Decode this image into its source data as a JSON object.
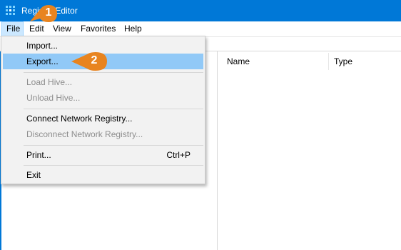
{
  "window": {
    "title": "Registry Editor",
    "icon": "regedit-icon"
  },
  "menubar": {
    "items": [
      {
        "label": "File"
      },
      {
        "label": "Edit"
      },
      {
        "label": "View"
      },
      {
        "label": "Favorites"
      },
      {
        "label": "Help"
      }
    ]
  },
  "file_menu": {
    "import": "Import...",
    "export": "Export...",
    "load_hive": "Load Hive...",
    "unload_hive": "Unload Hive...",
    "connect": "Connect Network Registry...",
    "disconnect": "Disconnect Network Registry...",
    "print": "Print...",
    "print_shortcut": "Ctrl+P",
    "exit": "Exit"
  },
  "list_view": {
    "columns": [
      "Name",
      "Type"
    ]
  },
  "callouts": {
    "step1": "1",
    "step2": "2",
    "color": "#e8841f"
  },
  "colors": {
    "titlebar": "#0078d7",
    "menu_hover": "#91c9f7"
  }
}
